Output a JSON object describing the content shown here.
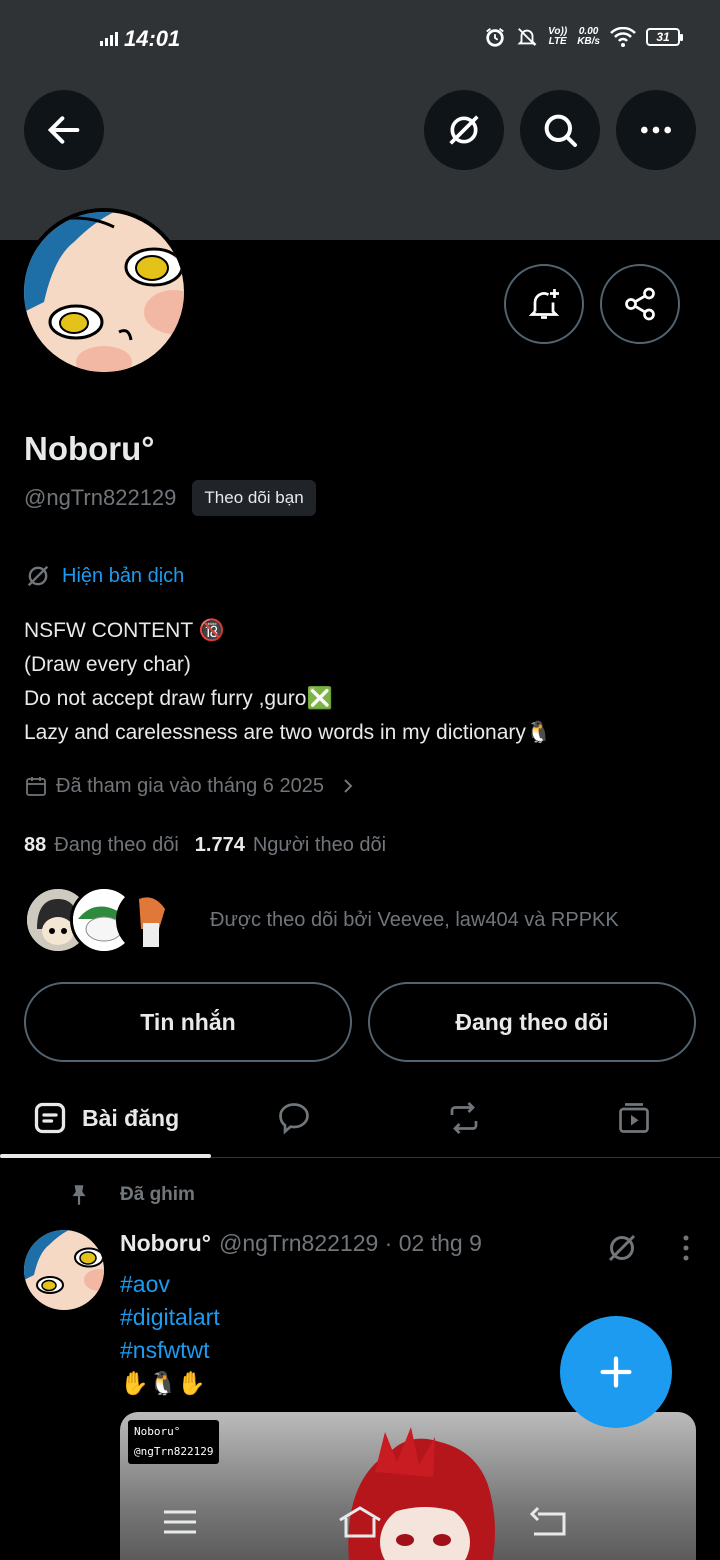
{
  "status_bar": {
    "time": "14:01",
    "net_speed_value": "0.00",
    "net_speed_unit": "KB/s",
    "volte_top": "Vo))",
    "volte_bottom": "LTE",
    "battery": "31"
  },
  "header": {
    "back_icon": "arrow-left-icon",
    "grok_icon": "grok-icon",
    "search_icon": "search-icon",
    "more_icon": "more-horizontal-icon"
  },
  "profile": {
    "display_name": "Noboru°",
    "handle": "@ngTrn822129",
    "follows_you_badge": "Theo dõi bạn",
    "translate_link": "Hiện bản dịch",
    "bio_lines": [
      "NSFW CONTENT 🔞",
      "(Draw every char)",
      "Do not accept draw furry ,guro❎",
      "Lazy and carelessness are two words in my dictionary🐧"
    ],
    "joined": "Đã tham gia vào tháng 6 2025",
    "following_count": "88",
    "following_label": "Đang theo dõi",
    "followers_count": "1.774",
    "followers_label": "Người theo dõi",
    "followed_by": "Được theo dõi bởi Veevee, law404 và RPPKK"
  },
  "actions": {
    "message_label": "Tin nhắn",
    "following_label": "Đang theo dõi"
  },
  "tabs": {
    "posts_label": "Bài đăng"
  },
  "pinned_post": {
    "pinned_label": "Đã ghim",
    "author_name": "Noboru°",
    "meta": "@ngTrn822129 · 02 thg 9",
    "hashtags": [
      "#aov",
      "#digitalart",
      "#nsfwtwt"
    ],
    "emoji_line": "✋🐧✋",
    "watermark_name": "Noboru°",
    "watermark_handle": "@ngTrn822129"
  },
  "colors": {
    "accent": "#1d9bf0",
    "banner": "#2f3336",
    "muted_text": "#71767b"
  }
}
